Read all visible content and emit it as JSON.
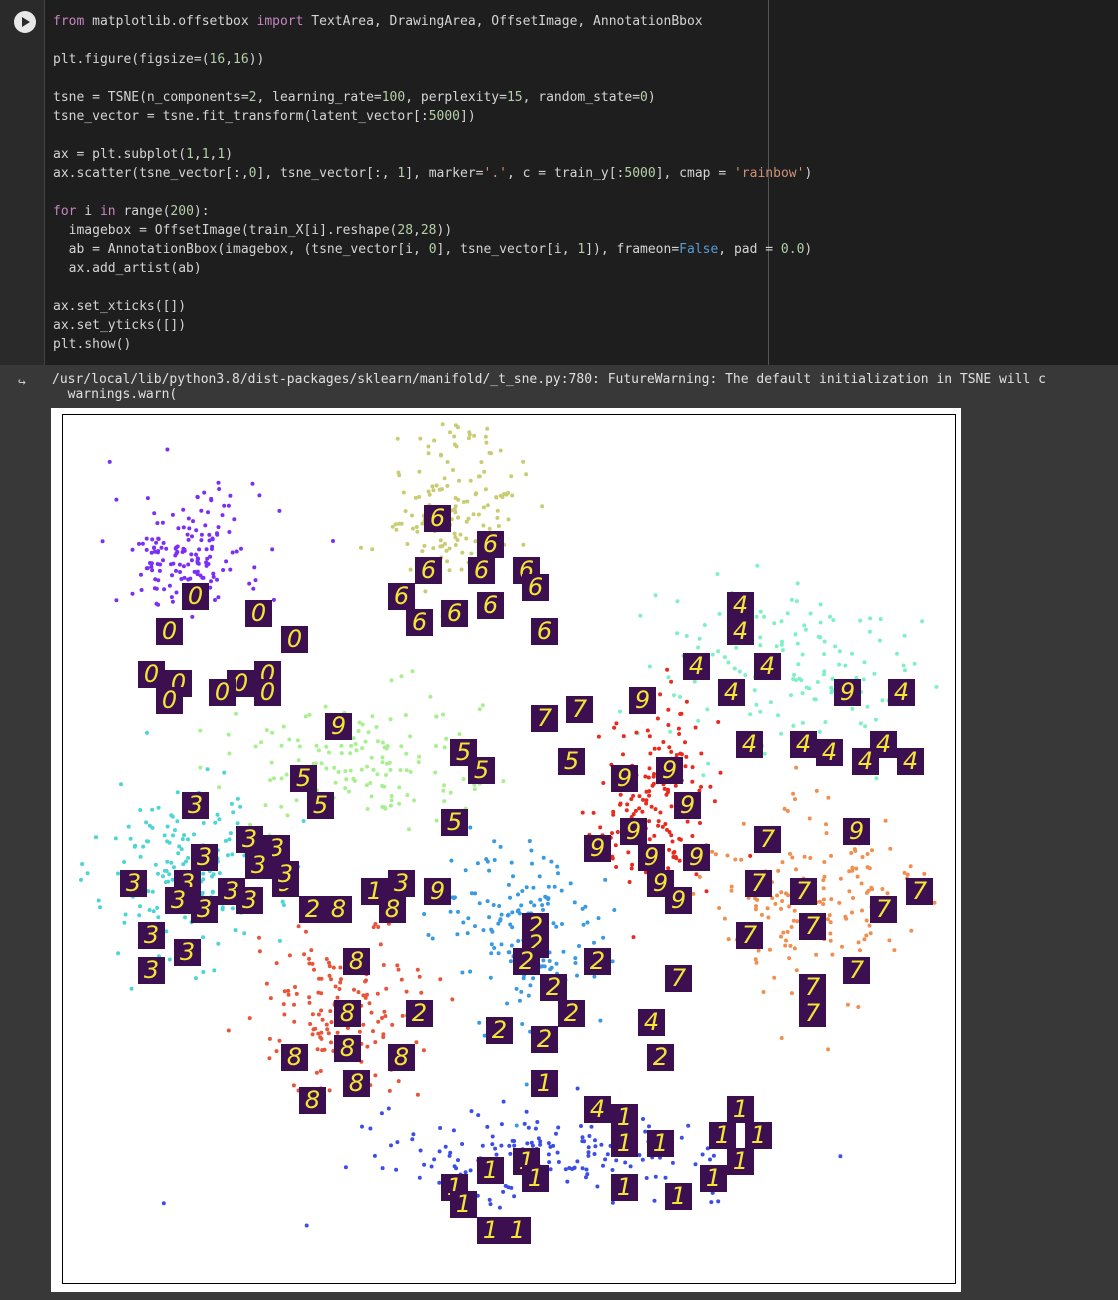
{
  "code_cell": {
    "lines": [
      [
        [
          "kw",
          "from"
        ],
        [
          "t",
          " matplotlib.offsetbox "
        ],
        [
          "kw",
          "import"
        ],
        [
          "t",
          " TextArea, DrawingArea, OffsetImage, AnnotationBbox"
        ]
      ],
      [
        [
          "t",
          ""
        ]
      ],
      [
        [
          "t",
          "plt.figure(figsize=("
        ],
        [
          "num",
          "16"
        ],
        [
          "t",
          ","
        ],
        [
          "num",
          "16"
        ],
        [
          "t",
          "))"
        ]
      ],
      [
        [
          "t",
          ""
        ]
      ],
      [
        [
          "t",
          "tsne = TSNE(n_components="
        ],
        [
          "num",
          "2"
        ],
        [
          "t",
          ", learning_rate="
        ],
        [
          "num",
          "100"
        ],
        [
          "t",
          ", perplexity="
        ],
        [
          "num",
          "15"
        ],
        [
          "t",
          ", random_state="
        ],
        [
          "num",
          "0"
        ],
        [
          "t",
          ")"
        ]
      ],
      [
        [
          "t",
          "tsne_vector = tsne.fit_transform(latent_vector[:"
        ],
        [
          "num",
          "5000"
        ],
        [
          "t",
          "])"
        ]
      ],
      [
        [
          "t",
          ""
        ]
      ],
      [
        [
          "t",
          "ax = plt.subplot("
        ],
        [
          "num",
          "1"
        ],
        [
          "t",
          ","
        ],
        [
          "num",
          "1"
        ],
        [
          "t",
          ","
        ],
        [
          "num",
          "1"
        ],
        [
          "t",
          ")"
        ]
      ],
      [
        [
          "t",
          "ax.scatter(tsne_vector[:,"
        ],
        [
          "num",
          "0"
        ],
        [
          "t",
          "], tsne_vector[:, "
        ],
        [
          "num",
          "1"
        ],
        [
          "t",
          "], marker="
        ],
        [
          "str",
          "'.'"
        ],
        [
          "t",
          ", c = train_y[:"
        ],
        [
          "num",
          "5000"
        ],
        [
          "t",
          "], cmap = "
        ],
        [
          "str",
          "'rainbow'"
        ],
        [
          "t",
          ")"
        ]
      ],
      [
        [
          "t",
          ""
        ]
      ],
      [
        [
          "kw",
          "for"
        ],
        [
          "t",
          " i "
        ],
        [
          "kw",
          "in"
        ],
        [
          "t",
          " range("
        ],
        [
          "num",
          "200"
        ],
        [
          "t",
          "):"
        ]
      ],
      [
        [
          "t",
          "  imagebox = OffsetImage(train_X[i].reshape("
        ],
        [
          "num",
          "28"
        ],
        [
          "t",
          ","
        ],
        [
          "num",
          "28"
        ],
        [
          "t",
          "))"
        ]
      ],
      [
        [
          "t",
          "  ab = AnnotationBbox(imagebox, (tsne_vector[i, "
        ],
        [
          "num",
          "0"
        ],
        [
          "t",
          "], tsne_vector[i, "
        ],
        [
          "num",
          "1"
        ],
        [
          "t",
          "]), frameon="
        ],
        [
          "kw2",
          "False"
        ],
        [
          "t",
          ", pad = "
        ],
        [
          "num",
          "0.0"
        ],
        [
          "t",
          ")"
        ]
      ],
      [
        [
          "t",
          "  ax.add_artist(ab)"
        ]
      ],
      [
        [
          "t",
          ""
        ]
      ],
      [
        [
          "t",
          "ax.set_xticks([])"
        ]
      ],
      [
        [
          "t",
          "ax.set_yticks([])"
        ]
      ],
      [
        [
          "t",
          "plt.show()"
        ]
      ]
    ]
  },
  "output": {
    "warning_line1": "/usr/local/lib/python3.8/dist-packages/sklearn/manifold/_t_sne.py:780: FutureWarning: The default initialization in TSNE will c",
    "warning_line2": "  warnings.warn("
  },
  "chart_data": {
    "type": "scatter",
    "title": "",
    "xlabel": "",
    "ylabel": "",
    "xticks": [],
    "yticks": [],
    "grid": false,
    "legend": "none",
    "xlim": [
      0,
      100
    ],
    "ylim": [
      0,
      100
    ],
    "cmap": "rainbow",
    "clusters": [
      {
        "label": "0",
        "color": "#7b2ff5",
        "center": [
          14,
          84
        ],
        "spread": [
          7,
          6
        ],
        "count": 160
      },
      {
        "label": "1",
        "color": "#3d4ee6",
        "center": [
          55,
          15
        ],
        "spread": [
          17,
          4
        ],
        "count": 170
      },
      {
        "label": "2",
        "color": "#3a9ae0",
        "center": [
          52,
          40
        ],
        "spread": [
          8,
          9
        ],
        "count": 160
      },
      {
        "label": "3",
        "color": "#4dd4d4",
        "center": [
          14,
          48
        ],
        "spread": [
          8,
          9
        ],
        "count": 160
      },
      {
        "label": "4",
        "color": "#7ff0c4",
        "center": [
          80,
          71
        ],
        "spread": [
          12,
          8
        ],
        "count": 150
      },
      {
        "label": "5",
        "color": "#a8f08f",
        "center": [
          33,
          60
        ],
        "spread": [
          13,
          6
        ],
        "count": 150
      },
      {
        "label": "6",
        "color": "#c9cc72",
        "center": [
          44,
          90
        ],
        "spread": [
          6,
          8
        ],
        "count": 150
      },
      {
        "label": "7",
        "color": "#f08f50",
        "center": [
          84,
          44
        ],
        "spread": [
          9,
          9
        ],
        "count": 160
      },
      {
        "label": "8",
        "color": "#e8553a",
        "center": [
          31,
          32
        ],
        "spread": [
          8,
          8
        ],
        "count": 160
      },
      {
        "label": "9",
        "color": "#e82a1f",
        "center": [
          67,
          56
        ],
        "spread": [
          6,
          9
        ],
        "count": 170
      }
    ],
    "annotations": [
      {
        "d": "6",
        "x": 42,
        "y": 88
      },
      {
        "d": "6",
        "x": 48,
        "y": 85
      },
      {
        "d": "6",
        "x": 41,
        "y": 82
      },
      {
        "d": "6",
        "x": 47,
        "y": 82
      },
      {
        "d": "6",
        "x": 52,
        "y": 82
      },
      {
        "d": "6",
        "x": 53,
        "y": 80
      },
      {
        "d": "6",
        "x": 38,
        "y": 79
      },
      {
        "d": "6",
        "x": 44,
        "y": 77
      },
      {
        "d": "6",
        "x": 48,
        "y": 78
      },
      {
        "d": "6",
        "x": 40,
        "y": 76
      },
      {
        "d": "6",
        "x": 54,
        "y": 75
      },
      {
        "d": "0",
        "x": 15,
        "y": 79
      },
      {
        "d": "0",
        "x": 22,
        "y": 77
      },
      {
        "d": "0",
        "x": 12,
        "y": 75
      },
      {
        "d": "0",
        "x": 26,
        "y": 74
      },
      {
        "d": "0",
        "x": 10,
        "y": 70
      },
      {
        "d": "0",
        "x": 13,
        "y": 69
      },
      {
        "d": "0",
        "x": 20,
        "y": 69
      },
      {
        "d": "0",
        "x": 23,
        "y": 70
      },
      {
        "d": "0",
        "x": 18,
        "y": 68
      },
      {
        "d": "0",
        "x": 12,
        "y": 67
      },
      {
        "d": "0",
        "x": 23,
        "y": 68
      },
      {
        "d": "9",
        "x": 31,
        "y": 64
      },
      {
        "d": "9",
        "x": 65,
        "y": 67
      },
      {
        "d": "9",
        "x": 63,
        "y": 58
      },
      {
        "d": "9",
        "x": 68,
        "y": 59
      },
      {
        "d": "9",
        "x": 70,
        "y": 55
      },
      {
        "d": "9",
        "x": 64,
        "y": 52
      },
      {
        "d": "9",
        "x": 60,
        "y": 50
      },
      {
        "d": "9",
        "x": 66,
        "y": 49
      },
      {
        "d": "9",
        "x": 71,
        "y": 49
      },
      {
        "d": "9",
        "x": 67,
        "y": 46
      },
      {
        "d": "9",
        "x": 69,
        "y": 44
      },
      {
        "d": "9",
        "x": 88,
        "y": 68
      },
      {
        "d": "9",
        "x": 89,
        "y": 52
      },
      {
        "d": "9",
        "x": 42,
        "y": 45
      },
      {
        "d": "9",
        "x": 25,
        "y": 46
      },
      {
        "d": "4",
        "x": 76,
        "y": 78
      },
      {
        "d": "4",
        "x": 76,
        "y": 75
      },
      {
        "d": "4",
        "x": 71,
        "y": 71
      },
      {
        "d": "4",
        "x": 79,
        "y": 71
      },
      {
        "d": "4",
        "x": 75,
        "y": 68
      },
      {
        "d": "4",
        "x": 94,
        "y": 68
      },
      {
        "d": "4",
        "x": 77,
        "y": 62
      },
      {
        "d": "4",
        "x": 83,
        "y": 62
      },
      {
        "d": "4",
        "x": 86,
        "y": 61
      },
      {
        "d": "4",
        "x": 92,
        "y": 62
      },
      {
        "d": "4",
        "x": 95,
        "y": 60
      },
      {
        "d": "4",
        "x": 90,
        "y": 60
      },
      {
        "d": "4",
        "x": 66,
        "y": 30
      },
      {
        "d": "4",
        "x": 60,
        "y": 20
      },
      {
        "d": "7",
        "x": 58,
        "y": 66
      },
      {
        "d": "7",
        "x": 54,
        "y": 65
      },
      {
        "d": "7",
        "x": 79,
        "y": 51
      },
      {
        "d": "7",
        "x": 78,
        "y": 46
      },
      {
        "d": "7",
        "x": 83,
        "y": 45
      },
      {
        "d": "7",
        "x": 96,
        "y": 45
      },
      {
        "d": "7",
        "x": 92,
        "y": 43
      },
      {
        "d": "7",
        "x": 84,
        "y": 41
      },
      {
        "d": "7",
        "x": 77,
        "y": 40
      },
      {
        "d": "7",
        "x": 89,
        "y": 36
      },
      {
        "d": "7",
        "x": 84,
        "y": 34
      },
      {
        "d": "7",
        "x": 84,
        "y": 31
      },
      {
        "d": "7",
        "x": 69,
        "y": 35
      },
      {
        "d": "5",
        "x": 45,
        "y": 61
      },
      {
        "d": "5",
        "x": 47,
        "y": 59
      },
      {
        "d": "5",
        "x": 57,
        "y": 60
      },
      {
        "d": "5",
        "x": 27,
        "y": 58
      },
      {
        "d": "5",
        "x": 29,
        "y": 55
      },
      {
        "d": "5",
        "x": 44,
        "y": 53
      },
      {
        "d": "3",
        "x": 15,
        "y": 55
      },
      {
        "d": "3",
        "x": 21,
        "y": 51
      },
      {
        "d": "3",
        "x": 24,
        "y": 50
      },
      {
        "d": "3",
        "x": 16,
        "y": 49
      },
      {
        "d": "3",
        "x": 22,
        "y": 48
      },
      {
        "d": "3",
        "x": 8,
        "y": 46
      },
      {
        "d": "3",
        "x": 14,
        "y": 46
      },
      {
        "d": "3",
        "x": 13,
        "y": 44
      },
      {
        "d": "3",
        "x": 16,
        "y": 43
      },
      {
        "d": "3",
        "x": 19,
        "y": 45
      },
      {
        "d": "3",
        "x": 21,
        "y": 44
      },
      {
        "d": "3",
        "x": 10,
        "y": 40
      },
      {
        "d": "3",
        "x": 14,
        "y": 38
      },
      {
        "d": "3",
        "x": 10,
        "y": 36
      },
      {
        "d": "3",
        "x": 38,
        "y": 46
      },
      {
        "d": "3",
        "x": 25,
        "y": 47
      },
      {
        "d": "8",
        "x": 31,
        "y": 43
      },
      {
        "d": "8",
        "x": 37,
        "y": 43
      },
      {
        "d": "8",
        "x": 33,
        "y": 37
      },
      {
        "d": "8",
        "x": 32,
        "y": 31
      },
      {
        "d": "8",
        "x": 32,
        "y": 27
      },
      {
        "d": "8",
        "x": 26,
        "y": 26
      },
      {
        "d": "8",
        "x": 38,
        "y": 26
      },
      {
        "d": "8",
        "x": 33,
        "y": 23
      },
      {
        "d": "8",
        "x": 28,
        "y": 21
      },
      {
        "d": "2",
        "x": 28,
        "y": 43
      },
      {
        "d": "2",
        "x": 53,
        "y": 41
      },
      {
        "d": "2",
        "x": 53,
        "y": 39
      },
      {
        "d": "2",
        "x": 52,
        "y": 37
      },
      {
        "d": "2",
        "x": 60,
        "y": 37
      },
      {
        "d": "2",
        "x": 55,
        "y": 34
      },
      {
        "d": "2",
        "x": 40,
        "y": 31
      },
      {
        "d": "2",
        "x": 49,
        "y": 29
      },
      {
        "d": "2",
        "x": 57,
        "y": 31
      },
      {
        "d": "2",
        "x": 54,
        "y": 28
      },
      {
        "d": "2",
        "x": 67,
        "y": 26
      },
      {
        "d": "1",
        "x": 35,
        "y": 45
      },
      {
        "d": "1",
        "x": 54,
        "y": 23
      },
      {
        "d": "1",
        "x": 63,
        "y": 19
      },
      {
        "d": "1",
        "x": 63,
        "y": 16
      },
      {
        "d": "1",
        "x": 67,
        "y": 16
      },
      {
        "d": "1",
        "x": 76,
        "y": 20
      },
      {
        "d": "1",
        "x": 74,
        "y": 17
      },
      {
        "d": "1",
        "x": 78,
        "y": 17
      },
      {
        "d": "1",
        "x": 76,
        "y": 14
      },
      {
        "d": "1",
        "x": 52,
        "y": 14
      },
      {
        "d": "1",
        "x": 53,
        "y": 12
      },
      {
        "d": "1",
        "x": 48,
        "y": 13
      },
      {
        "d": "1",
        "x": 44,
        "y": 11
      },
      {
        "d": "1",
        "x": 45,
        "y": 9
      },
      {
        "d": "1",
        "x": 63,
        "y": 11
      },
      {
        "d": "1",
        "x": 69,
        "y": 10
      },
      {
        "d": "1",
        "x": 73,
        "y": 12
      },
      {
        "d": "1",
        "x": 48,
        "y": 6
      },
      {
        "d": "1",
        "x": 51,
        "y": 6
      }
    ]
  }
}
